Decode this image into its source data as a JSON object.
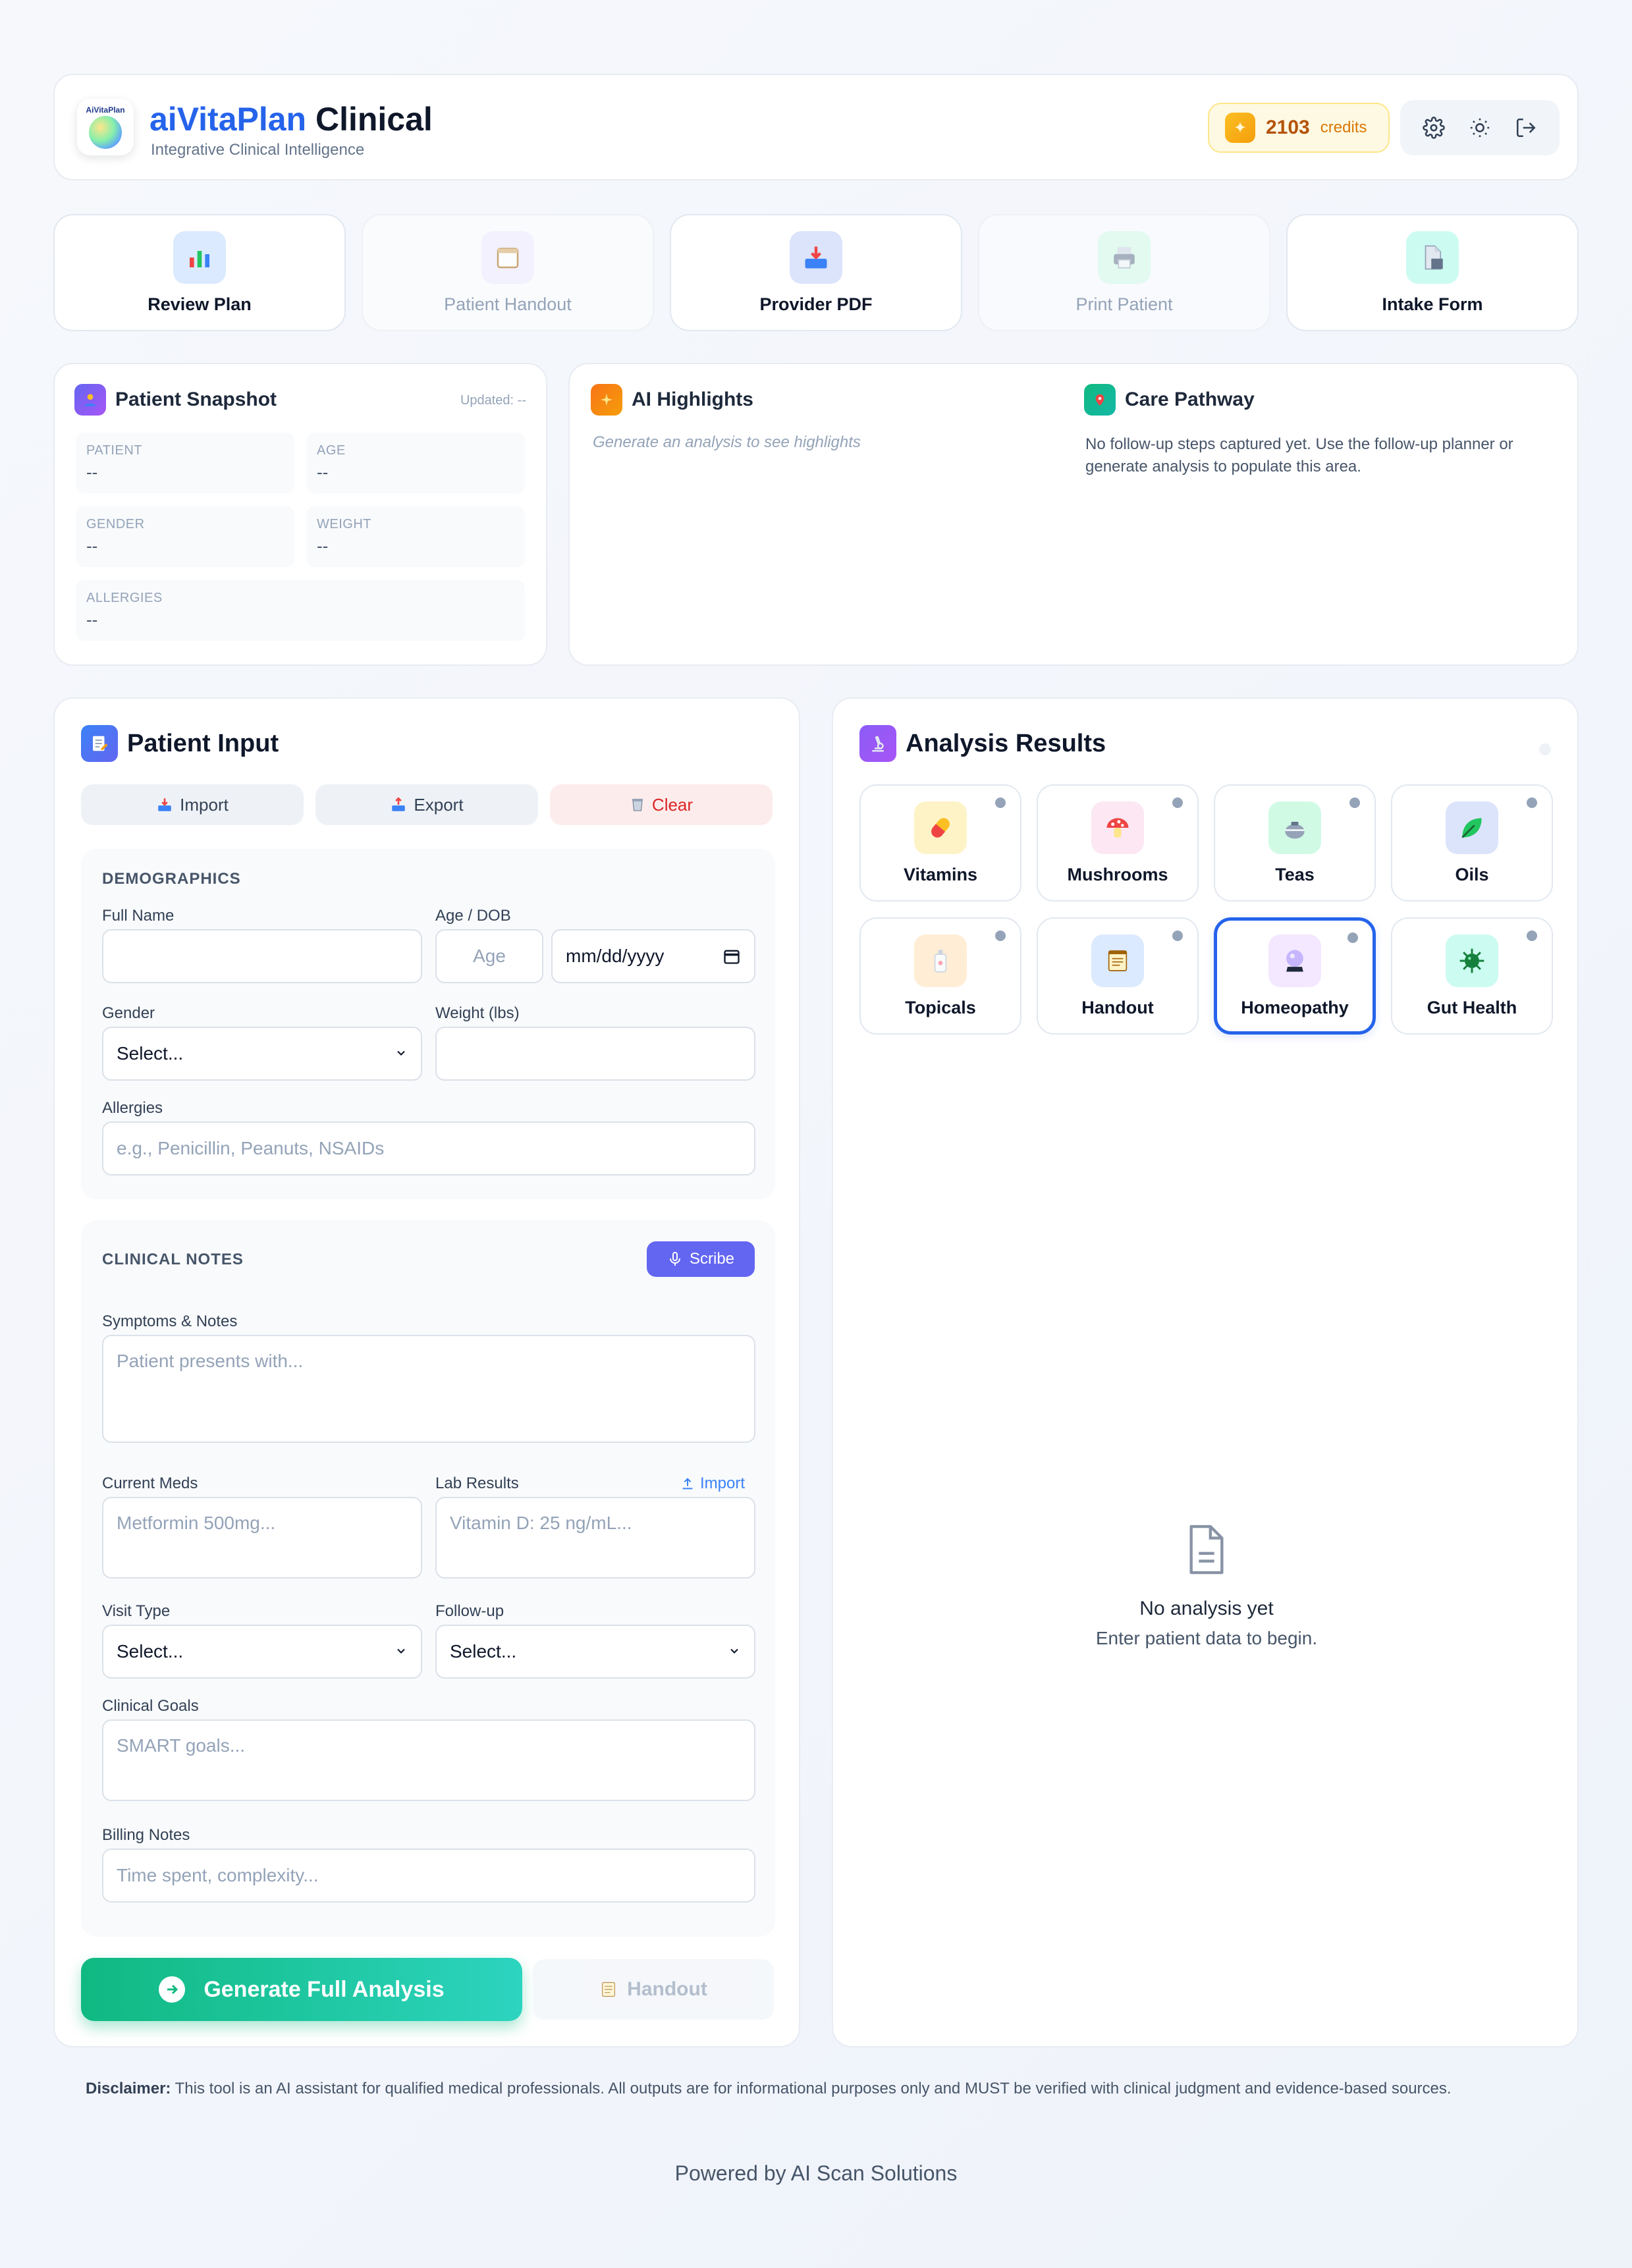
{
  "header": {
    "logo_text": "AiVitaPlan",
    "title_brand": "aiVitaPlan",
    "title_rest": " Clinical",
    "subtitle": "Integrative Clinical Intelligence",
    "credits_value": "2103",
    "credits_label": "credits",
    "icons": [
      "gear-icon",
      "sun-icon",
      "logout-icon"
    ]
  },
  "quick_actions": [
    {
      "label": "Review Plan",
      "icon": "bar-chart-icon",
      "enabled": true
    },
    {
      "label": "Patient Handout",
      "icon": "calendar-icon",
      "enabled": false
    },
    {
      "label": "Provider PDF",
      "icon": "inbox-tray-icon",
      "enabled": true
    },
    {
      "label": "Print Patient",
      "icon": "printer-icon",
      "enabled": false
    },
    {
      "label": "Intake Form",
      "icon": "document-icon",
      "enabled": true
    }
  ],
  "snapshot": {
    "title": "Patient Snapshot",
    "updated": "Updated: --",
    "fields": {
      "patient": {
        "label": "PATIENT",
        "value": "--"
      },
      "age": {
        "label": "AGE",
        "value": "--"
      },
      "gender": {
        "label": "GENDER",
        "value": "--"
      },
      "weight": {
        "label": "WEIGHT",
        "value": "--"
      },
      "allergies": {
        "label": "ALLERGIES",
        "value": "--"
      }
    }
  },
  "highlights": {
    "title": "AI Highlights",
    "empty": "Generate an analysis to see highlights",
    "care_title": "Care Pathway",
    "care_text": "No follow-up steps captured yet. Use the follow-up planner or generate analysis to populate this area."
  },
  "input": {
    "title": "Patient Input",
    "import_label": "Import",
    "export_label": "Export",
    "clear_label": "Clear",
    "demographics": {
      "title": "DEMOGRAPHICS",
      "full_name_label": "Full Name",
      "full_name_value": "",
      "age_dob_label": "Age / DOB",
      "age_placeholder": "Age",
      "dob_placeholder": "mm/dd/yyyy",
      "gender_label": "Gender",
      "gender_value": "Select...",
      "weight_label": "Weight (lbs)",
      "weight_value": "",
      "allergies_label": "Allergies",
      "allergies_placeholder": "e.g., Penicillin, Peanuts, NSAIDs"
    },
    "clinical": {
      "title": "CLINICAL NOTES",
      "scribe_label": "Scribe",
      "symptoms_label": "Symptoms & Notes",
      "symptoms_placeholder": "Patient presents with...",
      "meds_label": "Current Meds",
      "meds_placeholder": "Metformin 500mg...",
      "labs_label": "Lab Results",
      "labs_import_label": "Import",
      "labs_placeholder": "Vitamin D: 25 ng/mL...",
      "visit_label": "Visit Type",
      "visit_value": "Select...",
      "followup_label": "Follow-up",
      "followup_value": "Select...",
      "goals_label": "Clinical Goals",
      "goals_placeholder": "SMART goals...",
      "billing_label": "Billing Notes",
      "billing_placeholder": "Time spent, complexity..."
    },
    "generate_label": "Generate Full Analysis",
    "handout_label": "Handout"
  },
  "analysis": {
    "title": "Analysis Results",
    "categories": [
      {
        "label": "Vitamins",
        "icon": "pill-icon",
        "active": false
      },
      {
        "label": "Mushrooms",
        "icon": "mushroom-icon",
        "active": false
      },
      {
        "label": "Teas",
        "icon": "teapot-icon",
        "active": false
      },
      {
        "label": "Oils",
        "icon": "leaf-icon",
        "active": false
      },
      {
        "label": "Topicals",
        "icon": "lotion-icon",
        "active": false
      },
      {
        "label": "Handout",
        "icon": "notepad-icon",
        "active": false
      },
      {
        "label": "Homeopathy",
        "icon": "crystal-ball-icon",
        "active": true
      },
      {
        "label": "Gut Health",
        "icon": "microbe-icon",
        "active": false
      }
    ],
    "empty_title": "No analysis yet",
    "empty_sub": "Enter patient data to begin."
  },
  "footer": {
    "disclaimer_label": "Disclaimer:",
    "disclaimer_text": " This tool is an AI assistant for qualified medical professionals. All outputs are for informational purposes only and MUST be verified with clinical judgment and evidence-based sources.",
    "powered": "Powered by AI Scan Solutions"
  },
  "colors": {
    "brand": "#2563eb",
    "accent_green": "#10b981",
    "scribe": "#6366f1",
    "clear": "#dc2626",
    "credits": "#b45309"
  }
}
